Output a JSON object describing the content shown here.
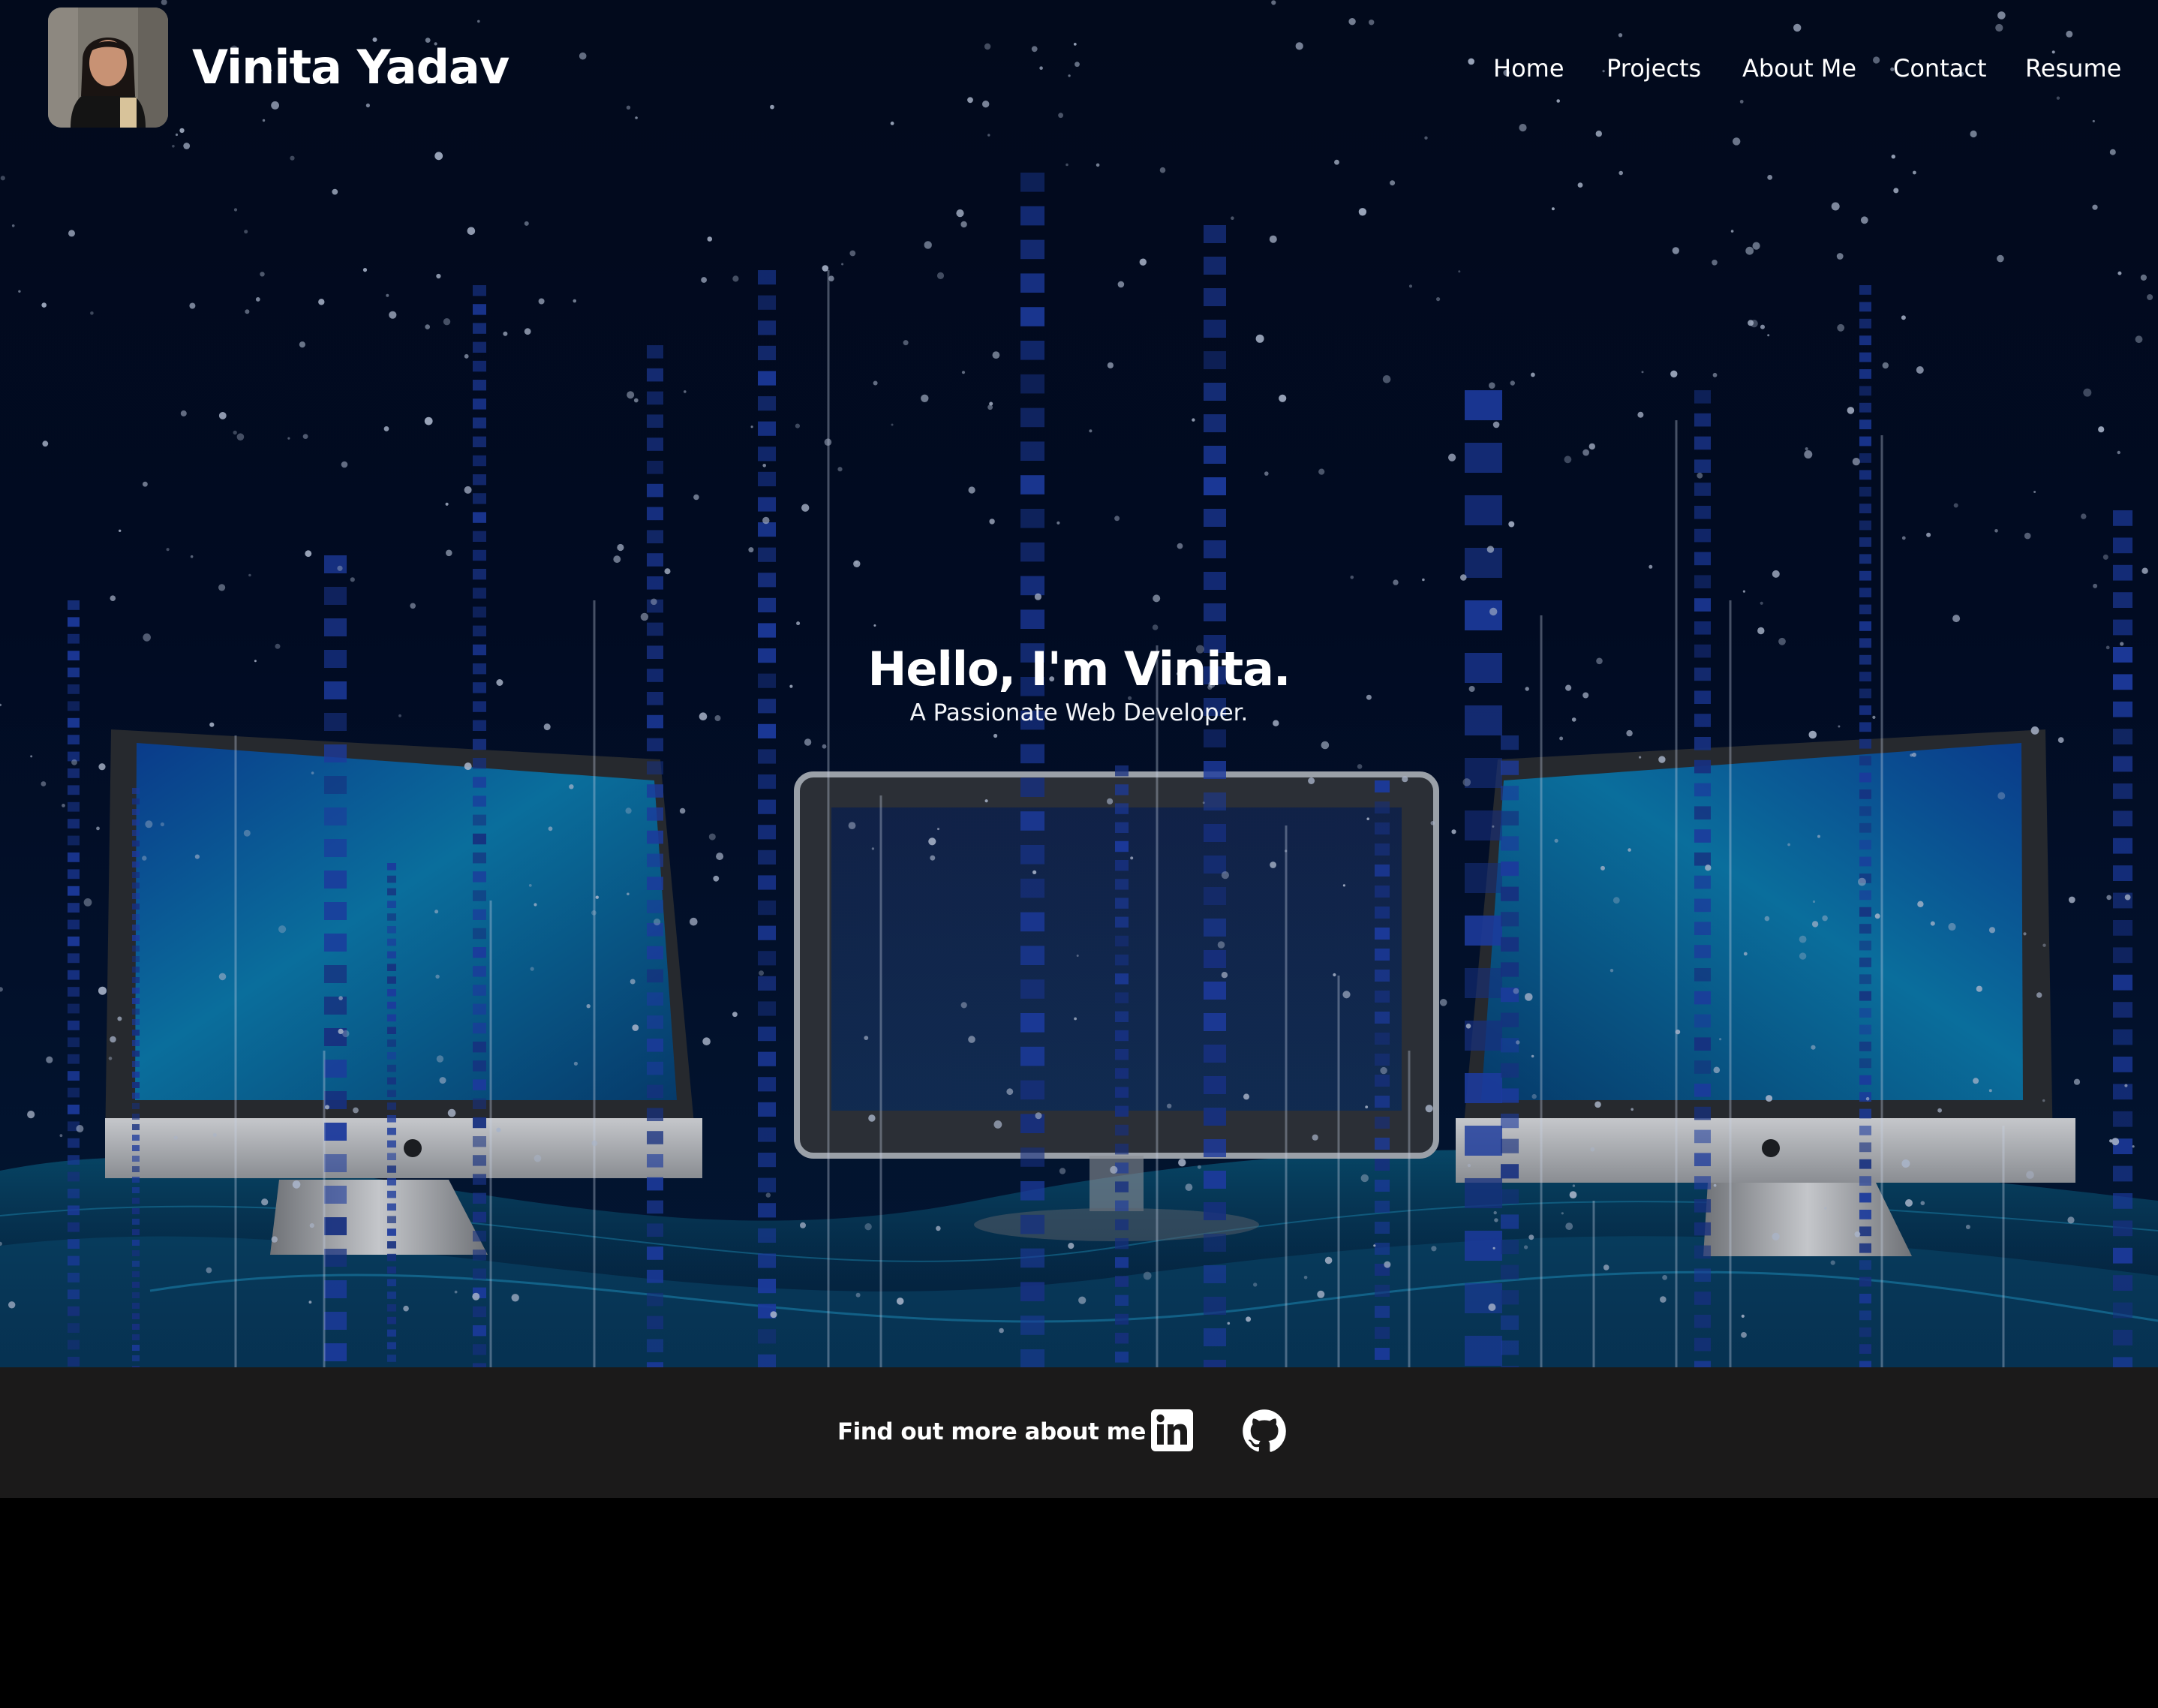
{
  "header": {
    "brand_name": "Vinita Yadav",
    "nav": [
      {
        "label": "Home"
      },
      {
        "label": "Projects"
      },
      {
        "label": "About Me"
      },
      {
        "label": "Contact"
      },
      {
        "label": "Resume"
      }
    ]
  },
  "hero": {
    "title": "Hello, I'm Vinita.",
    "subtitle": "A Passionate Web Developer."
  },
  "footer": {
    "label": "Find out more about me at:",
    "icons": [
      "linkedin-icon",
      "github-icon"
    ]
  },
  "colors": {
    "page_background": "#000000",
    "hero_background": "#020a1c",
    "footer_background": "#1b1a1a",
    "text": "#ffffff"
  }
}
